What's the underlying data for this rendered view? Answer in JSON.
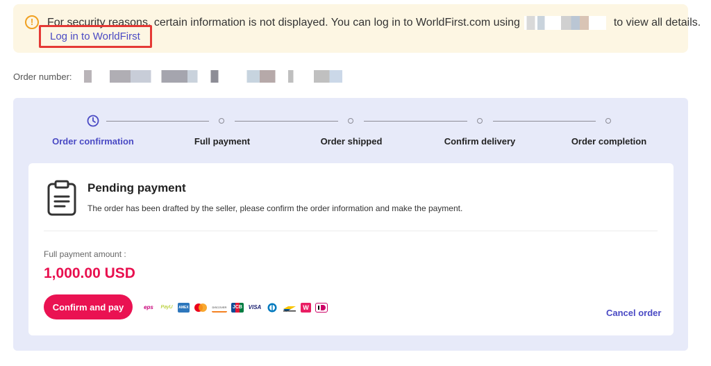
{
  "notice": {
    "icon": "warning-circle-icon",
    "message": "For security reasons, certain information is not displayed. You can log in to WorldFirst.com using",
    "message_end": "to view all details.",
    "login_link": "Log in to WorldFirst",
    "accent_color": "#f0a020"
  },
  "order": {
    "number_label": "Order number:"
  },
  "steps": [
    {
      "label": "Order confirmation",
      "active": true
    },
    {
      "label": "Full payment",
      "active": false
    },
    {
      "label": "Order shipped",
      "active": false
    },
    {
      "label": "Confirm delivery",
      "active": false
    },
    {
      "label": "Order completion",
      "active": false
    }
  ],
  "card": {
    "icon": "clipboard-icon",
    "title": "Pending payment",
    "description": "The order has been drafted by the seller, please confirm the order information and make the payment.",
    "amount_label": "Full payment amount :",
    "amount": "1,000.00 USD",
    "confirm_button": "Confirm and pay",
    "cancel_link": "Cancel order"
  },
  "payment_methods": [
    {
      "name": "eps-icon",
      "text": "eps"
    },
    {
      "name": "payu-icon",
      "text": "PayU"
    },
    {
      "name": "amex-icon",
      "text": "AMEX"
    },
    {
      "name": "mastercard-icon",
      "text": ""
    },
    {
      "name": "discover-icon",
      "text": "DISCOVER"
    },
    {
      "name": "jcb-icon",
      "text": "JCB"
    },
    {
      "name": "visa-icon",
      "text": "VISA"
    },
    {
      "name": "diners-icon",
      "text": ""
    },
    {
      "name": "bancontact-icon",
      "text": ""
    },
    {
      "name": "wechat-icon",
      "text": "W"
    },
    {
      "name": "ideal-icon",
      "text": ""
    }
  ],
  "colors": {
    "brand": "#4a4ac4",
    "primary_button": "#ea1252",
    "panel_bg": "#e7eaf9"
  }
}
